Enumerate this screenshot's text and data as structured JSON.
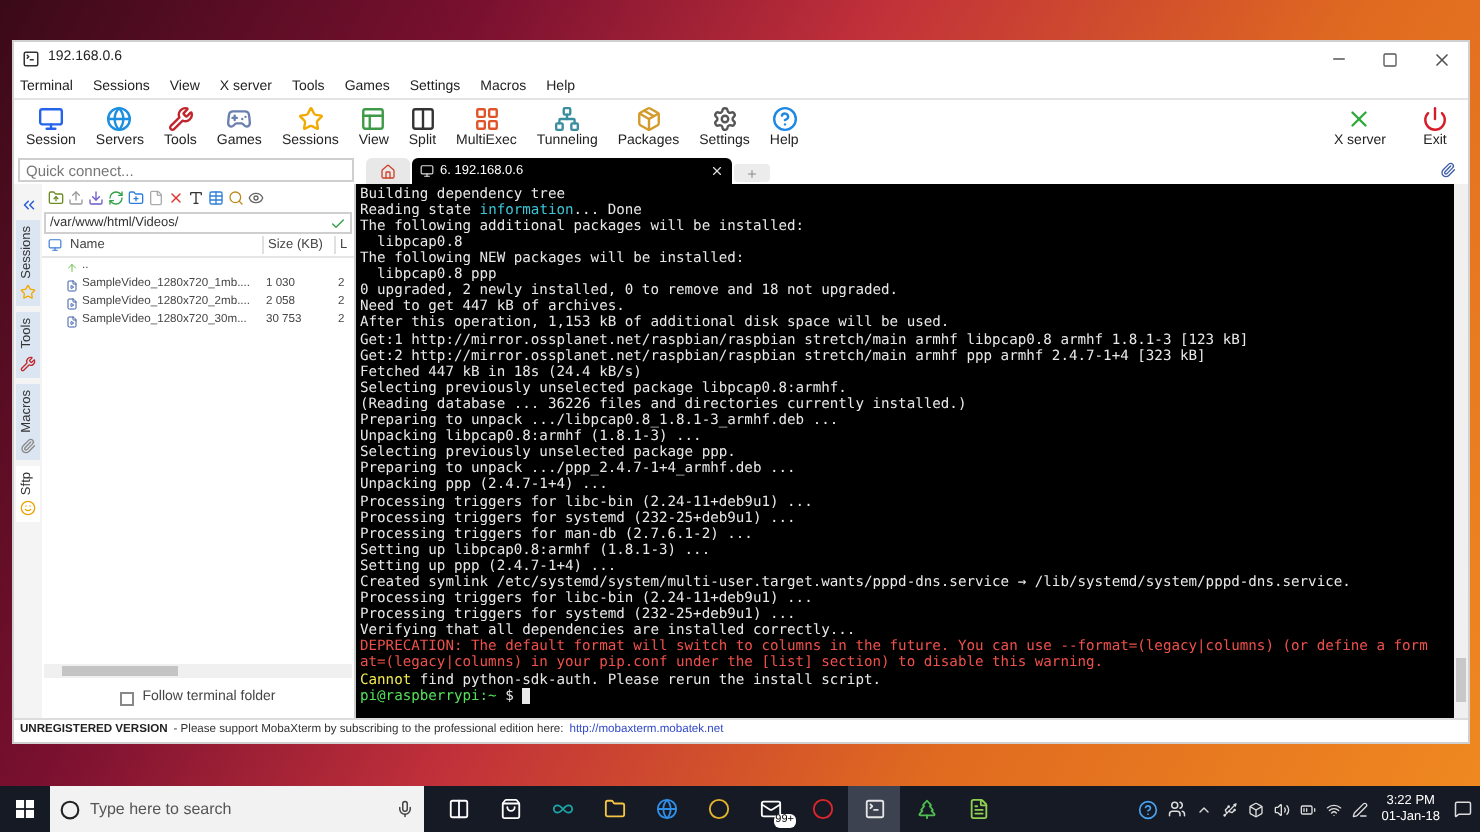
{
  "window": {
    "title": "192.168.0.6"
  },
  "menu": [
    "Terminal",
    "Sessions",
    "View",
    "X server",
    "Tools",
    "Games",
    "Settings",
    "Macros",
    "Help"
  ],
  "toolbar": [
    {
      "label": "Session",
      "kind": "session"
    },
    {
      "label": "Servers",
      "kind": "servers"
    },
    {
      "label": "Tools",
      "kind": "tools"
    },
    {
      "label": "Games",
      "kind": "games"
    },
    {
      "label": "Sessions",
      "kind": "sessions"
    },
    {
      "label": "View",
      "kind": "view"
    },
    {
      "label": "Split",
      "kind": "split"
    },
    {
      "label": "MultiExec",
      "kind": "multiexec"
    },
    {
      "label": "Tunneling",
      "kind": "tunneling"
    },
    {
      "label": "Packages",
      "kind": "packages"
    },
    {
      "label": "Settings",
      "kind": "settings"
    },
    {
      "label": "Help",
      "kind": "help"
    }
  ],
  "toolbar_right": [
    {
      "label": "X server",
      "kind": "xserver"
    },
    {
      "label": "Exit",
      "kind": "exit"
    }
  ],
  "quick_connect": {
    "placeholder": "Quick connect..."
  },
  "tabs": [
    {
      "kind": "home",
      "selected": false
    },
    {
      "kind": "session",
      "label": "6. 192.168.0.6",
      "selected": true
    }
  ],
  "side_tabs": [
    {
      "label": "Sessions",
      "kind": "sessions",
      "selected": false
    },
    {
      "label": "Tools",
      "kind": "tools",
      "selected": false
    },
    {
      "label": "Macros",
      "kind": "macros",
      "selected": false
    },
    {
      "label": "Sftp",
      "kind": "sftp",
      "selected": true
    }
  ],
  "sftp": {
    "path": "/var/www/html/Videos/",
    "columns": [
      "Name",
      "Size (KB)",
      "L"
    ],
    "rows": [
      {
        "kind": "folder",
        "name": ".."
      },
      {
        "kind": "file",
        "name": "SampleVideo_1280x720_1mb....",
        "size": "1 030",
        "column_4": "2"
      },
      {
        "kind": "file",
        "name": "SampleVideo_1280x720_2mb....",
        "size": "2 058",
        "column_4": "2"
      },
      {
        "kind": "file",
        "name": "SampleVideo_1280x720_30m...",
        "size": "30 753",
        "column_4": "2"
      }
    ],
    "follow_terminal_folder": {
      "label": "Follow terminal folder",
      "checked": false
    }
  },
  "terminal": {
    "lines": [
      {
        "text": "Building dependency tree",
        "color": "#e8e8e8"
      },
      {
        "segments": [
          {
            "text": "Reading state ",
            "color": "#e8e8e8"
          },
          {
            "text": "information",
            "color": "#3bc6d6"
          },
          {
            "text": "... Done",
            "color": "#e8e8e8"
          }
        ]
      },
      {
        "text": "The following additional packages will be installed:",
        "color": "#e8e8e8"
      },
      {
        "text": "  libpcap0.8",
        "color": "#e8e8e8"
      },
      {
        "text": "The following NEW packages will be installed:",
        "color": "#e8e8e8"
      },
      {
        "text": "  libpcap0.8 ppp",
        "color": "#e8e8e8"
      },
      {
        "text": "0 upgraded, 2 newly installed, 0 to remove and 18 not upgraded.",
        "color": "#e8e8e8"
      },
      {
        "text": "Need to get 447 kB of archives.",
        "color": "#e8e8e8"
      },
      {
        "text": "After this operation, 1,153 kB of additional disk space will be used.",
        "color": "#e8e8e8"
      },
      {
        "text": "Get:1 http://mirror.ossplanet.net/raspbian/raspbian stretch/main armhf libpcap0.8 armhf 1.8.1-3 [123 kB]",
        "color": "#e8e8e8"
      },
      {
        "text": "Get:2 http://mirror.ossplanet.net/raspbian/raspbian stretch/main armhf ppp armhf 2.4.7-1+4 [323 kB]",
        "color": "#e8e8e8"
      },
      {
        "text": "Fetched 447 kB in 18s (24.4 kB/s)",
        "color": "#e8e8e8"
      },
      {
        "text": "Selecting previously unselected package libpcap0.8:armhf.",
        "color": "#e8e8e8"
      },
      {
        "text": "(Reading database ... 36226 files and directories currently installed.)",
        "color": "#e8e8e8"
      },
      {
        "text": "Preparing to unpack .../libpcap0.8_1.8.1-3_armhf.deb ...",
        "color": "#e8e8e8"
      },
      {
        "text": "Unpacking libpcap0.8:armhf (1.8.1-3) ...",
        "color": "#e8e8e8"
      },
      {
        "text": "Selecting previously unselected package ppp.",
        "color": "#e8e8e8"
      },
      {
        "text": "Preparing to unpack .../ppp_2.4.7-1+4_armhf.deb ...",
        "color": "#e8e8e8"
      },
      {
        "text": "Unpacking ppp (2.4.7-1+4) ...",
        "color": "#e8e8e8"
      },
      {
        "text": "Processing triggers for libc-bin (2.24-11+deb9u1) ...",
        "color": "#e8e8e8"
      },
      {
        "text": "Processing triggers for systemd (232-25+deb9u1) ...",
        "color": "#e8e8e8"
      },
      {
        "text": "Processing triggers for man-db (2.7.6.1-2) ...",
        "color": "#e8e8e8"
      },
      {
        "text": "Setting up libpcap0.8:armhf (1.8.1-3) ...",
        "color": "#e8e8e8"
      },
      {
        "text": "Setting up ppp (2.4.7-1+4) ...",
        "color": "#e8e8e8"
      },
      {
        "text": "Created symlink /etc/systemd/system/multi-user.target.wants/pppd-dns.service → /lib/systemd/system/pppd-dns.service.",
        "color": "#e8e8e8"
      },
      {
        "text": "Processing triggers for libc-bin (2.24-11+deb9u1) ...",
        "color": "#e8e8e8"
      },
      {
        "text": "Processing triggers for systemd (232-25+deb9u1) ...",
        "color": "#e8e8e8"
      },
      {
        "text": "Verifying that all dependencies are installed correctly...",
        "color": "#e8e8e8"
      },
      {
        "text": "DEPRECATION: The default format will switch to columns in the future. You can use --format=(legacy|columns) (or define a form",
        "color": "#f0504a"
      },
      {
        "text": "at=(legacy|columns) in your pip.conf under the [list] section) to disable this warning.",
        "color": "#f0504a"
      },
      {
        "segments": [
          {
            "text": "Cannot",
            "color": "#f2e94e"
          },
          {
            "text": " find python-sdk-auth. Please rerun the install script.",
            "color": "#e8e8e8"
          }
        ]
      },
      {
        "kind": "prompt",
        "segments": [
          {
            "text": "pi@raspberrypi:~",
            "color": "#55e05a"
          },
          {
            "text": " $ ",
            "color": "#e8e8e8"
          }
        ]
      }
    ]
  },
  "status_bar": {
    "label": "UNREGISTERED VERSION",
    "message": "-  Please support MobaXterm by subscribing to the professional edition here:",
    "link": "http://mobaxterm.mobatek.net"
  },
  "taskbar": {
    "search": {
      "placeholder": "Type here to search"
    },
    "apps": [
      {
        "kind": "taskview",
        "selected": false
      },
      {
        "kind": "store",
        "selected": false
      },
      {
        "kind": "arduino",
        "selected": false
      },
      {
        "kind": "folder",
        "selected": false
      },
      {
        "kind": "edge",
        "selected": false
      },
      {
        "kind": "chrome",
        "selected": false
      },
      {
        "kind": "mail",
        "badge": "99+",
        "selected": false
      },
      {
        "kind": "opera",
        "selected": false
      },
      {
        "kind": "terminal",
        "selected": true
      },
      {
        "kind": "tree",
        "selected": false
      },
      {
        "kind": "notepad",
        "selected": false
      }
    ],
    "clock": {
      "time": "3:22 PM",
      "date": "01-Jan-18"
    }
  }
}
